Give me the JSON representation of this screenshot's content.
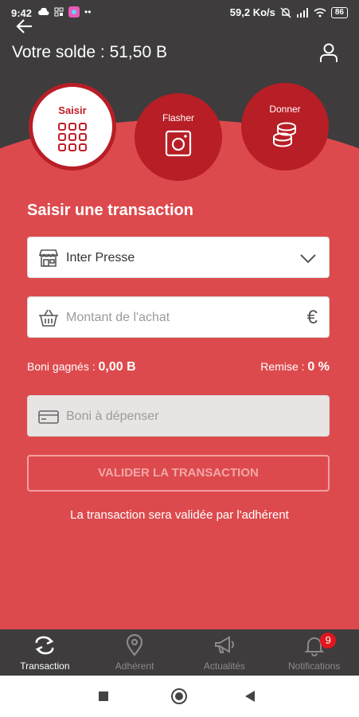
{
  "status": {
    "time": "9:42",
    "net_speed": "59,2 Ko/s",
    "battery": "86"
  },
  "header": {
    "balance": "Votre solde : 51,50 B"
  },
  "actions": [
    {
      "label": "Saisir",
      "icon": "grid-icon"
    },
    {
      "label": "Flasher",
      "icon": "camera-icon"
    },
    {
      "label": "Donner",
      "icon": "coins-icon"
    }
  ],
  "form": {
    "title": "Saisir une transaction",
    "shop_value": "Inter Presse",
    "amount_placeholder": "Montant de l'achat",
    "currency_symbol": "€",
    "boni_label": "Boni gagnés : ",
    "boni_value": "0,00 B",
    "remise_label": "Remise : ",
    "remise_value": "0 %",
    "spend_placeholder": "Boni à dépenser",
    "validate_label": "VALIDER LA TRANSACTION",
    "note": "La transaction sera validée par l'adhérent"
  },
  "nav": {
    "items": [
      {
        "label": "Transaction",
        "icon": "swap-icon"
      },
      {
        "label": "Adhérent",
        "icon": "location-pin-icon"
      },
      {
        "label": "Actualités",
        "icon": "megaphone-icon"
      },
      {
        "label": "Notifications",
        "icon": "bell-icon"
      }
    ],
    "badge": "9"
  },
  "colors": {
    "primary_red": "#dd4a4d",
    "dark_red": "#b81e25",
    "header_dark": "#3e3c3d"
  }
}
